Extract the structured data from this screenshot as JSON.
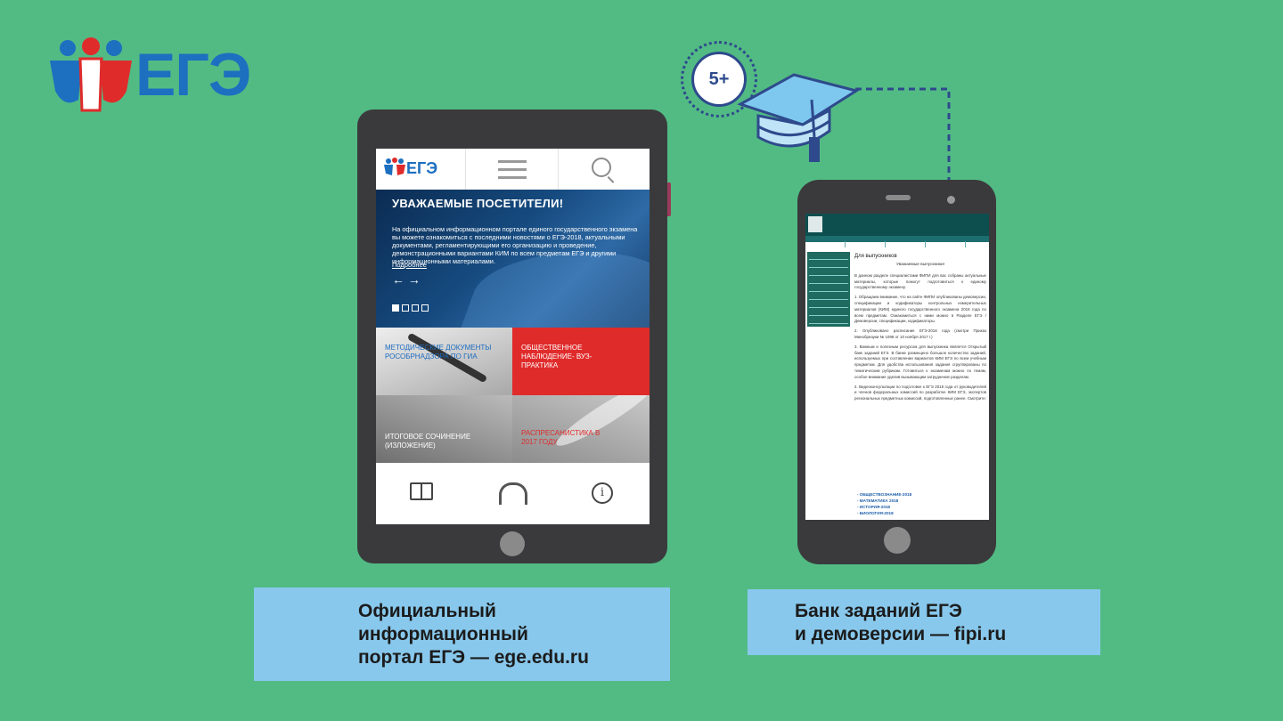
{
  "logo": {
    "text": "ЕГЭ"
  },
  "badge": {
    "text": "5+"
  },
  "tablet": {
    "header_logo": "ЕГЭ",
    "hero": {
      "title": "УВАЖАЕМЫЕ ПОСЕТИТЕЛИ!",
      "body": "На официальном информационном портале единого государственного экзамена вы можете ознакомиться с последними новостями о ЕГЭ-2018, актуальными документами, регламентирующими его организацию и проведение, демонстрационными вариантами КИМ по всем предметам ЕГЭ и другими информационными материалами.",
      "more": "Подробнее",
      "arrows": "← →"
    },
    "tiles": [
      "МЕТОДИЧЕСКИЕ ДОКУМЕНТЫ РОСОБРНАДЗОРА ПО ГИА",
      "ОБЩЕСТВЕННОЕ НАБЛЮДЕНИЕ- ВУЗ- ПРАКТИКА",
      "ИТОГОВОЕ СОЧИНЕНИЕ (ИЗЛОЖЕНИЕ)",
      "РАСПРЕСАНИСТИКА В 2017 ГОДУ"
    ],
    "info_glyph": "i"
  },
  "phone": {
    "page_title": "Для выпускников",
    "greeting": "Уважаемые выпускники!",
    "paragraphs": [
      "В данном разделе специалистами ФИПИ для вас собраны актуальные материалы, которые помогут подготовиться к единому государственному экзамену.",
      "1. Обращаем внимание, что на сайте ФИПИ опубликованы демоверсии, спецификации и кодификаторы контрольных измерительных материалов (КИМ) единого государственного экзамена 2018 года по всем предметам. Ознакомиться с ними можно в Разделе ЕГЭ / Демоверсии, спецификации, кодификаторы.",
      "2. Опубликовано расписание ЕГЭ-2018 года (смотри Приказ Минобрнауки № 1098 от 10 ноября 2017 г.)",
      "3. Важным и полезным ресурсом для выпускника является Открытый банк заданий ЕГЭ. В банке размещено большое количество заданий, используемых при составлении вариантов КИМ ЕГЭ по всем учебным предметам. Для удобства использования задания сгруппированы по тематическим рубрикам. Готовиться к экзаменам можно по темам, особое внимание уделив вызывающим затруднение разделам.",
      "4. Видеоконсультации по подготовке к ЕГЭ 2018 года от руководителей и членов федеральных комиссий по разработке КИМ ЕГЭ, экспертов региональных предметных комиссий, подготовленные ранее. Смотрите:"
    ],
    "links": [
      "- ОБЩЕСТВОЗНАНИЕ-2018",
      "- МАТЕМАТИКА 2018",
      "- ИСТОРИЯ-2018",
      "- БИОЛОГИЯ-2018"
    ]
  },
  "captions": {
    "left": [
      "Официальный",
      "информационный",
      "портал ЕГЭ — ege.edu.ru"
    ],
    "right": [
      "Банк заданий ЕГЭ",
      "и демоверсии — fipi.ru"
    ]
  },
  "colors": {
    "background": "#52bb84",
    "brand_blue": "#1d6fc0",
    "brand_red": "#e02b2b",
    "caption_bg": "#88c8ec",
    "badge": "#2e4a8c"
  }
}
